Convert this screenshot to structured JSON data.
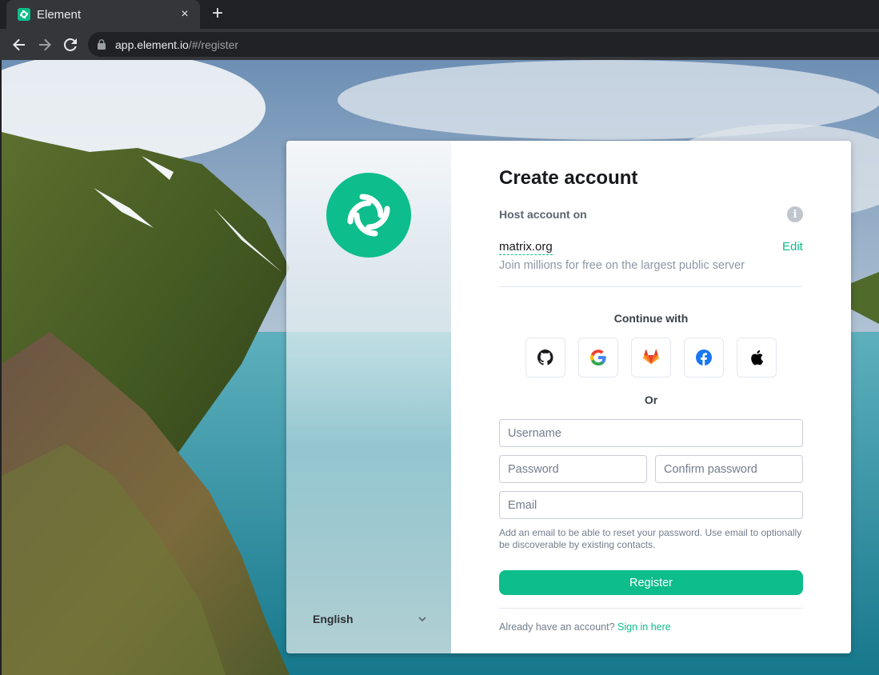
{
  "browser": {
    "tab_title": "Element",
    "tab_close": "×",
    "new_tab": "+",
    "url_host": "app.element.io",
    "url_path": "/#/register"
  },
  "auth": {
    "title": "Create account",
    "host_label": "Host account on",
    "server_name": "matrix.org",
    "edit_label": "Edit",
    "server_description": "Join millions for free on the largest public server",
    "continue_with": "Continue with",
    "sso_providers": [
      "github-icon",
      "google-icon",
      "gitlab-icon",
      "facebook-icon",
      "apple-icon"
    ],
    "or_label": "Or",
    "username_placeholder": "Username",
    "password_placeholder": "Password",
    "confirm_password_placeholder": "Confirm password",
    "email_placeholder": "Email",
    "email_hint": "Add an email to be able to reset your password. Use email to optionally be discoverable by existing contacts.",
    "register_label": "Register",
    "already_text": "Already have an account?",
    "sign_in_label": "Sign in here",
    "language": "English",
    "accent_color": "#0dbd8b"
  }
}
